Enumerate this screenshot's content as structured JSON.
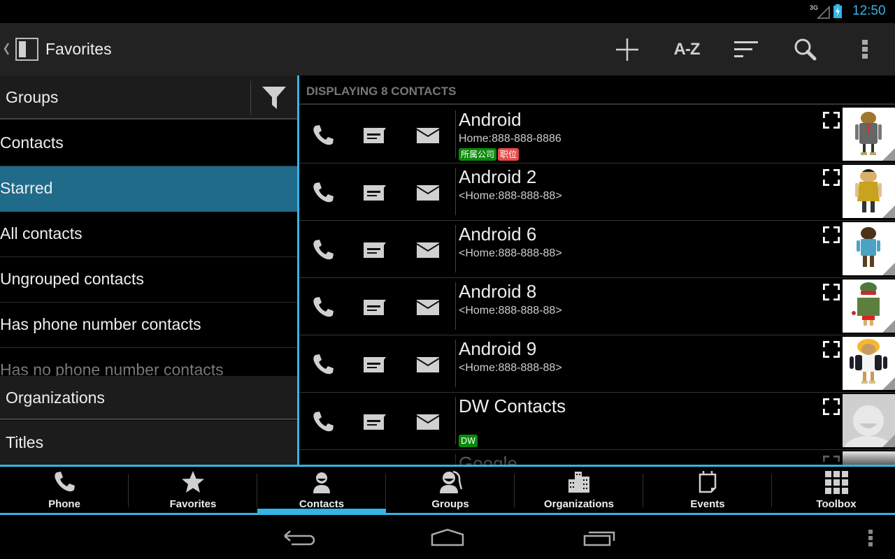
{
  "status_bar": {
    "network": "3G",
    "time": "12:50",
    "accent": "#33b5e5"
  },
  "action_bar": {
    "title": "Favorites",
    "actions": [
      {
        "name": "add",
        "icon": "plus-icon"
      },
      {
        "name": "sort-az",
        "label": "A-Z",
        "icon": "az-icon"
      },
      {
        "name": "sort",
        "icon": "sort-icon"
      },
      {
        "name": "search",
        "icon": "search-icon"
      },
      {
        "name": "overflow",
        "icon": "overflow-menu-icon"
      }
    ]
  },
  "left_panel": {
    "header": "Groups",
    "filter_icon": "filter-icon",
    "groups": [
      {
        "label": "Contacts",
        "selected": false
      },
      {
        "label": "Starred",
        "selected": true
      },
      {
        "label": "All contacts",
        "selected": false
      },
      {
        "label": "Ungrouped contacts",
        "selected": false
      },
      {
        "label": "Has phone number contacts",
        "selected": false
      },
      {
        "label": "Has no phone number contacts",
        "selected": false
      }
    ],
    "sections": [
      {
        "label": "Organizations"
      },
      {
        "label": "Titles"
      }
    ],
    "selected_color": "#206a8a"
  },
  "contacts_panel": {
    "count_label": "DISPLAYING 8 CONTACTS",
    "contacts": [
      {
        "name": "Android",
        "phone": "Home:888-888-8886",
        "tags": [
          {
            "text": "所属公司",
            "color": "#0a8a0a"
          },
          {
            "text": "职位",
            "color": "#e84a4a"
          }
        ],
        "avatar": "android-businessman"
      },
      {
        "name": "Android 2",
        "phone": "<Home:888-888-88>",
        "tags": [],
        "avatar": "android-yellow-dress"
      },
      {
        "name": "Android 6",
        "phone": "<Home:888-888-88>",
        "tags": [],
        "avatar": "android-hawaiian"
      },
      {
        "name": "Android 8",
        "phone": "<Home:888-888-88>",
        "tags": [],
        "avatar": "android-camo"
      },
      {
        "name": "Android 9",
        "phone": "<Home:888-888-88>",
        "tags": [],
        "avatar": "android-blonde"
      },
      {
        "name": "DW Contacts",
        "phone": "",
        "tags": [
          {
            "text": "DW",
            "color": "#0a8a0a"
          }
        ],
        "avatar": "default-person"
      },
      {
        "name": "Google",
        "phone": "",
        "tags": [],
        "avatar": "default-partial"
      }
    ]
  },
  "tab_bar": {
    "tabs": [
      {
        "label": "Phone",
        "icon": "phone-icon",
        "active": false
      },
      {
        "label": "Favorites",
        "icon": "star-icon",
        "active": false
      },
      {
        "label": "Contacts",
        "icon": "contact-person-icon",
        "active": true
      },
      {
        "label": "Groups",
        "icon": "groups-icon",
        "active": false
      },
      {
        "label": "Organizations",
        "icon": "buildings-icon",
        "active": false
      },
      {
        "label": "Events",
        "icon": "calendar-icon",
        "active": false
      },
      {
        "label": "Toolbox",
        "icon": "grid-icon",
        "active": false
      }
    ]
  },
  "nav_bar": {
    "buttons": [
      {
        "name": "back",
        "icon": "back-icon"
      },
      {
        "name": "home",
        "icon": "home-icon"
      },
      {
        "name": "recents",
        "icon": "recents-icon"
      },
      {
        "name": "menu",
        "icon": "overflow-menu-icon"
      }
    ]
  }
}
